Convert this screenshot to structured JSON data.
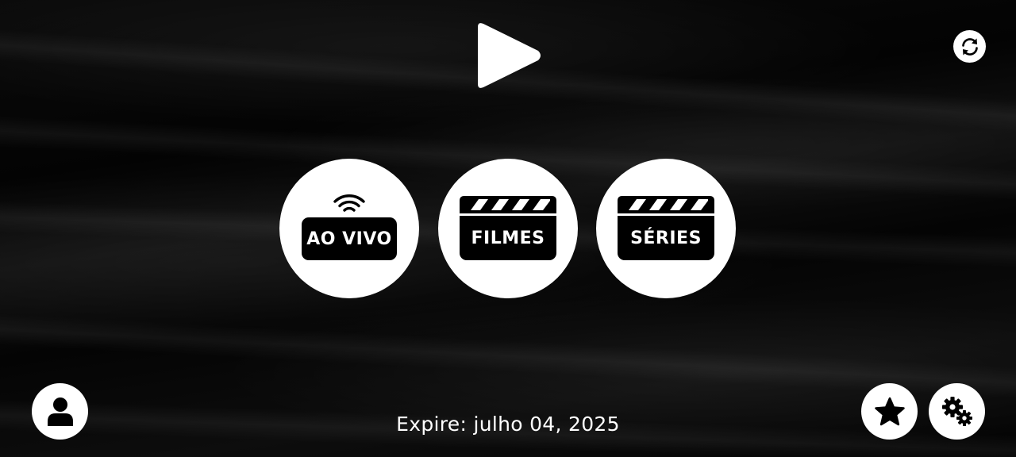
{
  "app": {
    "logo_icon": "play-icon"
  },
  "header": {
    "refresh_icon": "refresh-icon"
  },
  "categories": [
    {
      "id": "live",
      "label": "AO VIVO",
      "icon": "tv-signal-icon"
    },
    {
      "id": "movies",
      "label": "FILMES",
      "icon": "clapperboard-icon"
    },
    {
      "id": "series",
      "label": "SÉRIES",
      "icon": "clapperboard-icon"
    }
  ],
  "footer": {
    "expire_text": "Expire: julho 04, 2025",
    "profile_icon": "user-icon",
    "favorites_icon": "star-icon",
    "settings_icon": "gears-icon"
  },
  "colors": {
    "background": "#050505",
    "button": "#ffffff",
    "icon": "#000000",
    "text": "#ffffff"
  }
}
